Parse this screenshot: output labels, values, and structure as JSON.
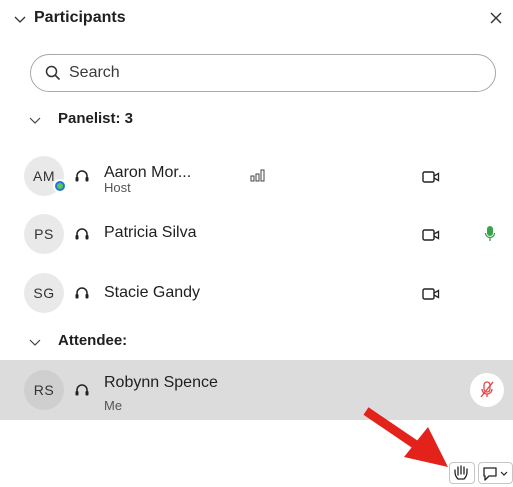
{
  "header": {
    "title": "Participants",
    "collapse_icon": "chevron-down-icon",
    "close_icon": "close-icon"
  },
  "search": {
    "placeholder": "Search",
    "value": "",
    "icon": "search-icon"
  },
  "panelists": {
    "label": "Panelist: 3",
    "items": [
      {
        "initials": "AM",
        "name": "Aaron Mor...",
        "role": "Host",
        "icons": [
          "headset-icon",
          "volume-bars-icon",
          "video-camera-icon"
        ],
        "status_color": "#1c78d4"
      },
      {
        "initials": "PS",
        "name": "Patricia Silva",
        "role": "",
        "icons": [
          "headset-icon",
          "video-camera-icon",
          "microphone-active-icon"
        ],
        "mic_color": "#3aa44a"
      },
      {
        "initials": "SG",
        "name": "Stacie Gandy",
        "role": "",
        "icons": [
          "headset-icon",
          "video-camera-icon"
        ]
      }
    ]
  },
  "attendees": {
    "label": "Attendee:",
    "items": [
      {
        "initials": "RS",
        "name": "Robynn Spence",
        "role": "Me",
        "icons": [
          "headset-icon",
          "microphone-muted-icon"
        ],
        "muted_color": "#e04848",
        "highlighted": true
      }
    ]
  },
  "bottom_bar": {
    "raise_hand_icon": "raise-hand-icon",
    "reactions_icon": "reactions-icon",
    "reactions_dropdown_icon": "chevron-down-icon"
  },
  "annotation": {
    "arrow_color": "#e4221c"
  }
}
